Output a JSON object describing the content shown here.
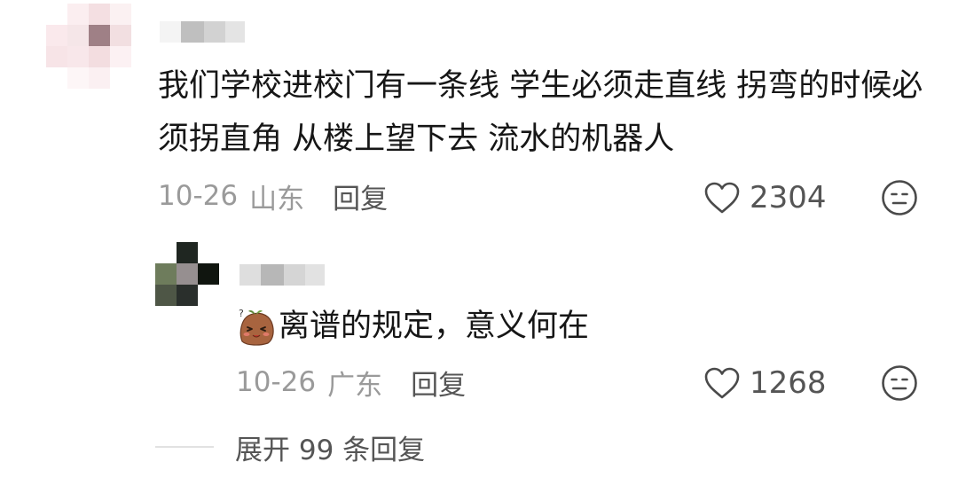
{
  "comment": {
    "avatar_colors": [
      "#ffffff",
      "#fbeef0",
      "#f4dfe2",
      "#fbf1f2",
      "#fae9ec",
      "#f5e6e8",
      "#9f8086",
      "#f2dfe1",
      "#f7e4e7",
      "#f8e7ea",
      "#f3dde0",
      "#fcf1f3",
      "#ffffff",
      "#fdf6f7",
      "#fbf0f2",
      "#ffffff"
    ],
    "username_blocks": [
      "#f4f4f4",
      "#bfbfbf",
      "#d2d2d2",
      "#e4e4e4"
    ],
    "text": "我们学校进校门有一条线 学生必须走直线 拐弯的时候必须拐直角 从楼上望下去 流水的机器人",
    "date": "10-26",
    "region": "山东",
    "reply_label": "回复",
    "likes": "2304"
  },
  "reply": {
    "avatar_colors": [
      "#ffffff",
      "#1f2621",
      "#ffffff",
      "#6e7c5c",
      "#968f90",
      "#10150f",
      "#4e5646",
      "#2a2f2c",
      "#ffffff"
    ],
    "username_blocks": [
      "#dedede",
      "#b7b7b7",
      "#d5d5d5",
      "#e2e2e2"
    ],
    "emoji_icon": "blushing-potato-emoji",
    "text": "离谱的规定，意义何在",
    "date": "10-26",
    "region": "广东",
    "reply_label": "回复",
    "likes": "1268"
  },
  "expand_label": "展开 99 条回复",
  "icons": {
    "like": "heart-outline-icon",
    "dislike": "unhappy-face-icon"
  },
  "colors": {
    "text": "#161616",
    "meta": "#9a9a9a",
    "action": "#555555"
  }
}
